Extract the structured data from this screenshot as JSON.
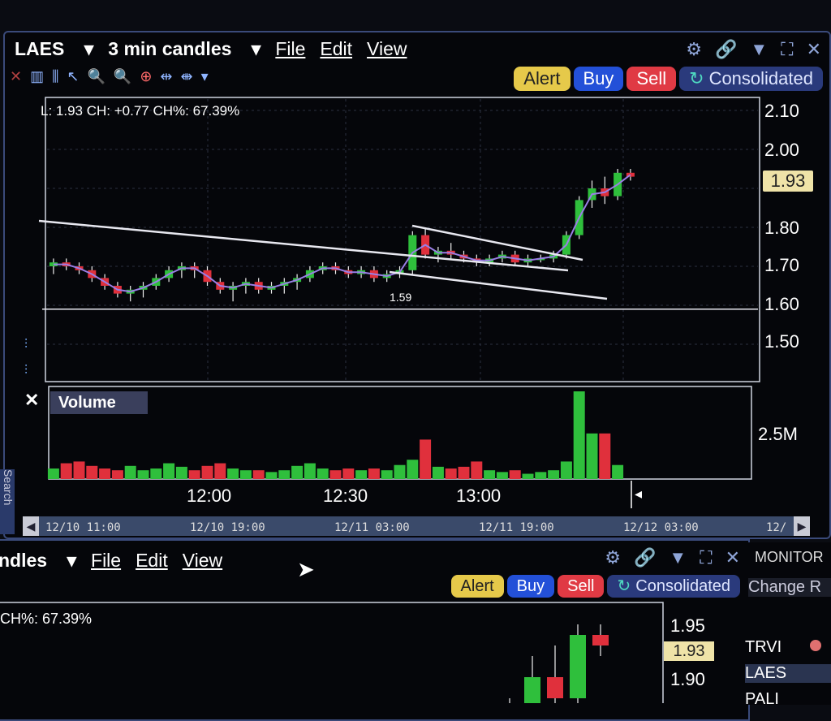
{
  "top_window": {
    "symbol": "LAES",
    "interval": "3 min candles",
    "menu": [
      "File",
      "Edit",
      "View"
    ],
    "buttons": {
      "alert": "Alert",
      "buy": "Buy",
      "sell": "Sell",
      "consolidated": "Consolidated"
    },
    "info_line": "L: 1.93 CH: +0.77 CH%: 67.39%",
    "last_price_tag": "1.93",
    "low_marker": "1.59",
    "volume_title": "Volume",
    "volume_axis_label": "2.5M",
    "time_ticks": [
      "12:00",
      "12:30",
      "13:00"
    ],
    "date_labels": [
      "12/10 11:00",
      "12/10 19:00",
      "12/11 03:00",
      "12/11 19:00",
      "12/12 03:00",
      "12/"
    ],
    "search_label": "Search"
  },
  "bottom_window": {
    "interval_partial": "ndles",
    "menu": [
      "File",
      "Edit",
      "View"
    ],
    "buttons": {
      "alert": "Alert",
      "buy": "Buy",
      "sell": "Sell",
      "consolidated": "Consolidated"
    },
    "info_partial": "CH%: 67.39%",
    "last_price_tag": "1.93",
    "y_ticks": [
      "1.95",
      "1.90"
    ]
  },
  "monitor": {
    "title": "MONITOR",
    "column": "Change R",
    "rows": [
      "TRVI",
      "LAES",
      "PALI"
    ]
  },
  "colors": {
    "up": "#2fbf3c",
    "down": "#e0303c",
    "ma": "#9a7fe6",
    "trend": "#e8e8f0",
    "accent": "#3a4a7a"
  },
  "chart_data": {
    "type": "candlestick",
    "ylim": [
      1.45,
      2.12
    ],
    "y_ticks": [
      1.5,
      1.6,
      1.7,
      1.8,
      1.9,
      2.0,
      2.1
    ],
    "horizontal_line": 1.59,
    "candles": [
      [
        1.7,
        1.72,
        1.68,
        1.71
      ],
      [
        1.71,
        1.72,
        1.69,
        1.7
      ],
      [
        1.7,
        1.71,
        1.68,
        1.69
      ],
      [
        1.69,
        1.7,
        1.66,
        1.67
      ],
      [
        1.67,
        1.68,
        1.64,
        1.65
      ],
      [
        1.65,
        1.66,
        1.62,
        1.63
      ],
      [
        1.63,
        1.65,
        1.61,
        1.64
      ],
      [
        1.64,
        1.66,
        1.62,
        1.65
      ],
      [
        1.65,
        1.68,
        1.64,
        1.67
      ],
      [
        1.67,
        1.7,
        1.66,
        1.69
      ],
      [
        1.69,
        1.71,
        1.67,
        1.7
      ],
      [
        1.7,
        1.71,
        1.67,
        1.69
      ],
      [
        1.69,
        1.7,
        1.65,
        1.66
      ],
      [
        1.66,
        1.67,
        1.63,
        1.64
      ],
      [
        1.64,
        1.66,
        1.61,
        1.65
      ],
      [
        1.65,
        1.67,
        1.63,
        1.66
      ],
      [
        1.66,
        1.67,
        1.63,
        1.64
      ],
      [
        1.64,
        1.66,
        1.63,
        1.65
      ],
      [
        1.65,
        1.67,
        1.63,
        1.66
      ],
      [
        1.66,
        1.68,
        1.64,
        1.67
      ],
      [
        1.67,
        1.7,
        1.66,
        1.69
      ],
      [
        1.69,
        1.71,
        1.68,
        1.7
      ],
      [
        1.7,
        1.71,
        1.68,
        1.69
      ],
      [
        1.69,
        1.7,
        1.67,
        1.68
      ],
      [
        1.68,
        1.7,
        1.67,
        1.69
      ],
      [
        1.69,
        1.7,
        1.66,
        1.67
      ],
      [
        1.67,
        1.69,
        1.66,
        1.68
      ],
      [
        1.68,
        1.7,
        1.67,
        1.69
      ],
      [
        1.69,
        1.79,
        1.68,
        1.78
      ],
      [
        1.78,
        1.8,
        1.72,
        1.73
      ],
      [
        1.73,
        1.75,
        1.71,
        1.74
      ],
      [
        1.74,
        1.76,
        1.72,
        1.73
      ],
      [
        1.73,
        1.74,
        1.71,
        1.72
      ],
      [
        1.72,
        1.73,
        1.7,
        1.71
      ],
      [
        1.71,
        1.73,
        1.7,
        1.72
      ],
      [
        1.72,
        1.74,
        1.71,
        1.73
      ],
      [
        1.73,
        1.74,
        1.7,
        1.71
      ],
      [
        1.71,
        1.73,
        1.7,
        1.72
      ],
      [
        1.72,
        1.73,
        1.71,
        1.72
      ],
      [
        1.72,
        1.74,
        1.71,
        1.73
      ],
      [
        1.73,
        1.79,
        1.72,
        1.78
      ],
      [
        1.78,
        1.88,
        1.77,
        1.87
      ],
      [
        1.87,
        1.92,
        1.85,
        1.9
      ],
      [
        1.9,
        1.93,
        1.86,
        1.88
      ],
      [
        1.88,
        1.95,
        1.87,
        1.94
      ],
      [
        1.94,
        1.95,
        1.92,
        1.93
      ]
    ],
    "volume_relative": [
      0.12,
      0.18,
      0.2,
      0.15,
      0.12,
      0.1,
      0.15,
      0.1,
      0.12,
      0.18,
      0.14,
      0.1,
      0.15,
      0.18,
      0.12,
      0.1,
      0.1,
      0.08,
      0.1,
      0.15,
      0.18,
      0.12,
      0.1,
      0.12,
      0.1,
      0.12,
      0.1,
      0.16,
      0.22,
      0.45,
      0.14,
      0.12,
      0.14,
      0.2,
      0.1,
      0.08,
      0.1,
      0.06,
      0.08,
      0.1,
      0.2,
      1.0,
      0.52,
      0.52,
      0.16,
      0.0
    ]
  }
}
